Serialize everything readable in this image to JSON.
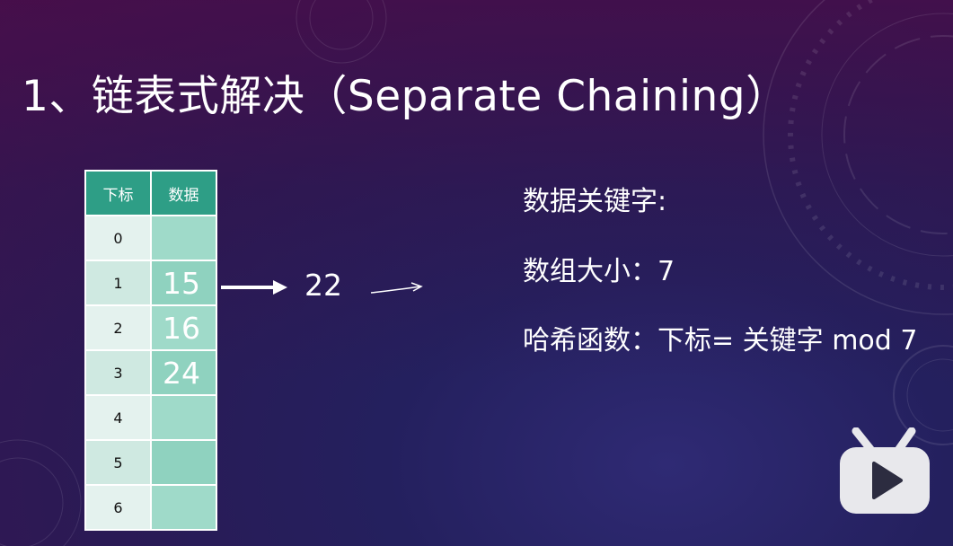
{
  "slide": {
    "title": "1、链表式解决（Separate Chaining）"
  },
  "table": {
    "headers": [
      "下标",
      "数据"
    ],
    "rows": [
      {
        "index": "0",
        "value": ""
      },
      {
        "index": "1",
        "value": "15"
      },
      {
        "index": "2",
        "value": "16"
      },
      {
        "index": "3",
        "value": "24"
      },
      {
        "index": "4",
        "value": ""
      },
      {
        "index": "5",
        "value": ""
      },
      {
        "index": "6",
        "value": ""
      }
    ]
  },
  "chain": {
    "value": "22"
  },
  "info": {
    "keys_label": "数据关键字:",
    "size_label": "数组大小：7",
    "hash_label": "哈希函数：下标= 关键字 mod 7"
  },
  "colors": {
    "header_bg": "#2e9e86",
    "data_cell_bg": "#9fdac9",
    "index_cell_bg": "#e4f2ee",
    "text": "#ffffff"
  },
  "icons": {
    "watermark": "bilibili-tv-icon"
  }
}
